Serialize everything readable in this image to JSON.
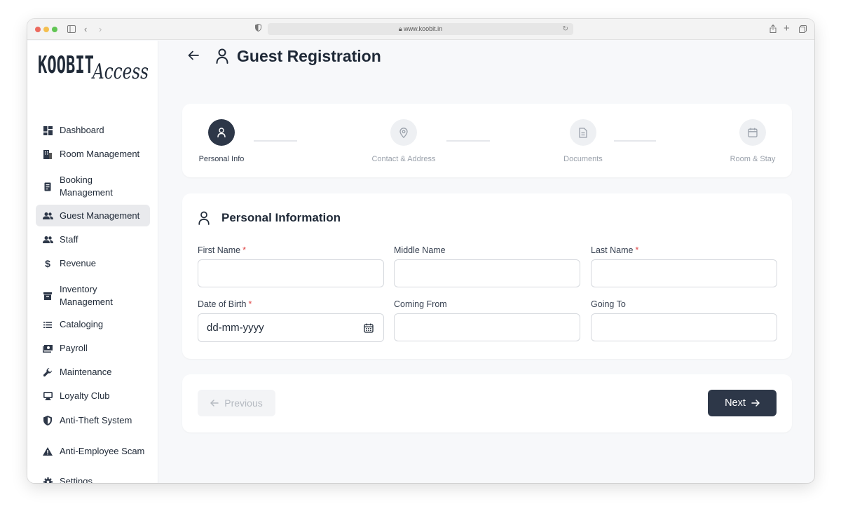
{
  "browser": {
    "url": "www.koobit.in"
  },
  "brand": {
    "logo_text_main": "KOOBIT",
    "logo_text_script": "Access"
  },
  "sidebar": {
    "items": [
      {
        "label": "Dashboard",
        "icon": "dashboard-icon"
      },
      {
        "label": "Room Management",
        "icon": "building-icon"
      },
      {
        "label": "Booking Management",
        "icon": "booking-icon"
      },
      {
        "label": "Guest Management",
        "icon": "guests-icon",
        "active": true
      },
      {
        "label": "Staff",
        "icon": "staff-icon"
      },
      {
        "label": "Revenue",
        "icon": "dollar-icon"
      },
      {
        "label": "Inventory Management",
        "icon": "inventory-icon"
      },
      {
        "label": "Cataloging",
        "icon": "list-icon"
      },
      {
        "label": "Payroll",
        "icon": "payroll-icon"
      },
      {
        "label": "Maintenance",
        "icon": "wrench-icon"
      },
      {
        "label": "Loyalty Club",
        "icon": "monitor-icon"
      },
      {
        "label": "Anti-Theft System",
        "icon": "shield-icon"
      },
      {
        "label": "Anti-Employee Scam",
        "icon": "warning-icon"
      },
      {
        "label": "Settings",
        "icon": "gear-icon"
      }
    ]
  },
  "page": {
    "title": "Guest Registration"
  },
  "stepper": {
    "steps": [
      {
        "label": "Personal Info",
        "icon": "user-icon",
        "active": true
      },
      {
        "label": "Contact & Address",
        "icon": "location-icon"
      },
      {
        "label": "Documents",
        "icon": "document-icon"
      },
      {
        "label": "Room & Stay",
        "icon": "calendar-icon"
      }
    ]
  },
  "form": {
    "section_title": "Personal Information",
    "required_mark": "*",
    "fields": {
      "first_name": {
        "label": "First Name",
        "value": ""
      },
      "middle_name": {
        "label": "Middle Name",
        "value": ""
      },
      "last_name": {
        "label": "Last Name",
        "value": ""
      },
      "dob": {
        "label": "Date of Birth",
        "placeholder": "dd-mm-yyyy"
      },
      "coming_from": {
        "label": "Coming From",
        "value": ""
      },
      "going_to": {
        "label": "Going To",
        "value": ""
      }
    }
  },
  "actions": {
    "previous_label": "Previous",
    "next_label": "Next"
  },
  "colors": {
    "primary": "#2d3748",
    "required": "#e04848",
    "active_nav_bg": "#e9eaed"
  }
}
